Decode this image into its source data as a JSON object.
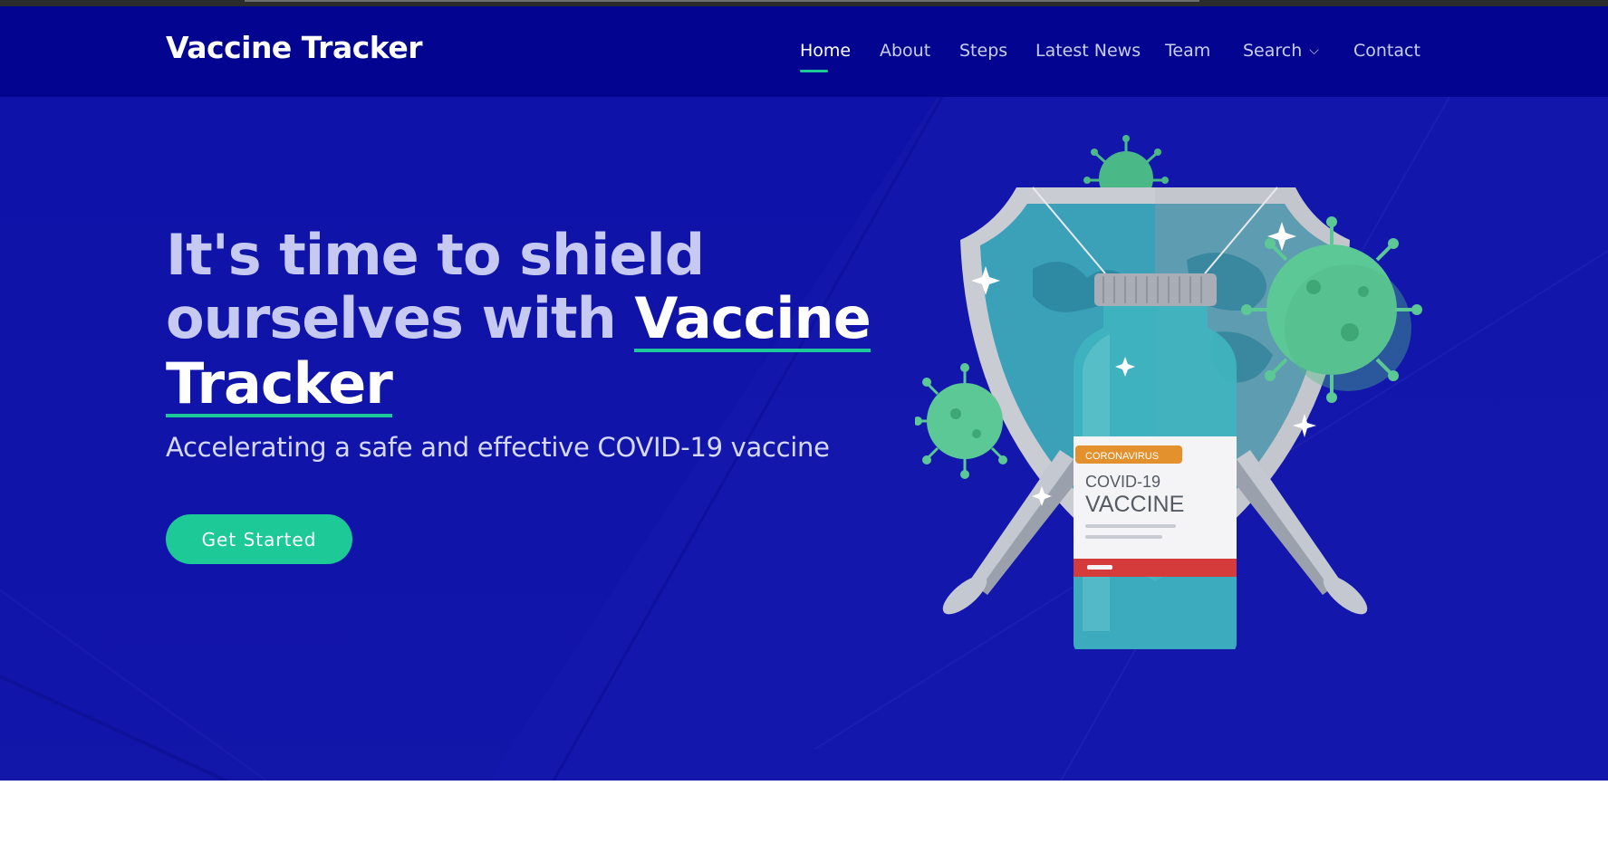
{
  "brand": {
    "title": "Vaccine Tracker"
  },
  "nav": {
    "items": [
      {
        "label": "Home"
      },
      {
        "label": "About"
      },
      {
        "label": "Steps"
      },
      {
        "label": "Latest News"
      },
      {
        "label": "Team"
      },
      {
        "label": "Search"
      },
      {
        "label": "Contact"
      }
    ],
    "active": "Home"
  },
  "hero": {
    "headline_plain": "It's time to shield ourselves with",
    "headline_highlight_1": "Vaccine",
    "headline_highlight_2": "Tracker",
    "subtitle": "Accelerating a safe and effective COVID-19 vaccine",
    "cta_label": "Get Started"
  },
  "illustration": {
    "label_tag": "CORONAVIRUS",
    "label_line1": "COVID-19",
    "label_line2": "VACCINE"
  },
  "colors": {
    "nav_bg": "#030590",
    "hero_bg": "#1316a9",
    "accent": "#1dc997",
    "virus": "#5cc896"
  },
  "icons": {
    "search_dropdown": "chevron-down-icon"
  }
}
